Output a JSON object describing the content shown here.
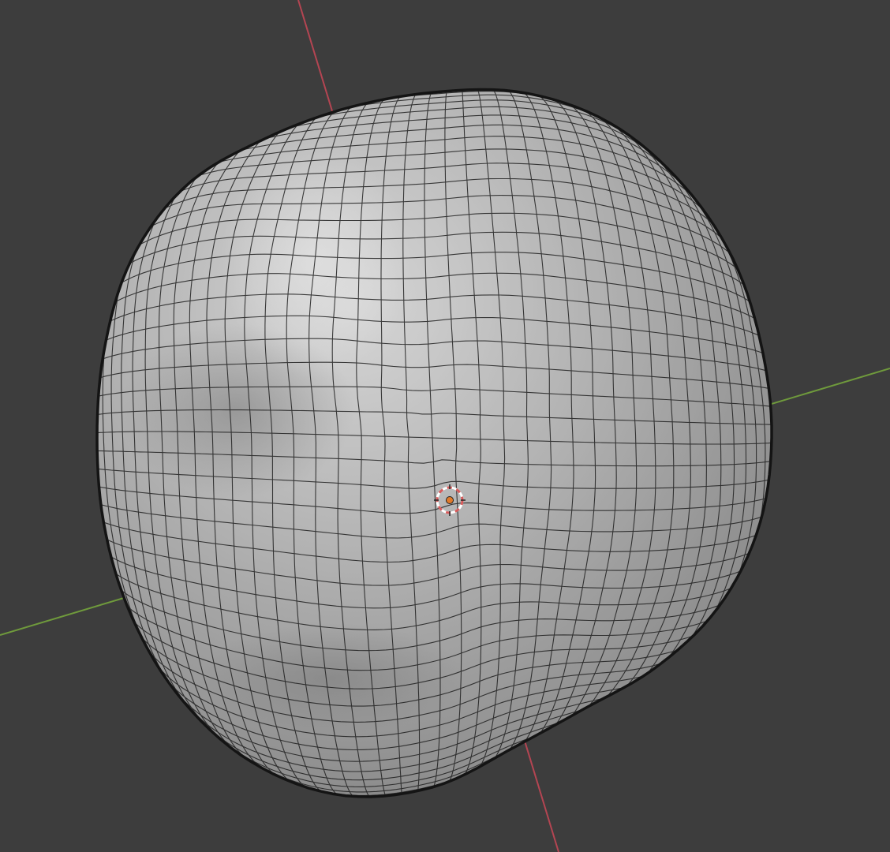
{
  "viewport": {
    "mode": "3d-viewport",
    "shading": "solid-with-wireframe-overlay",
    "object": "mesh-blob"
  },
  "colors": {
    "background": "#3d3d3d",
    "x_axis": "#b44552",
    "y_axis": "#6f9a3c",
    "mesh_base": "#a9a9a9",
    "mesh_highlight": "#d4d4d4",
    "mesh_shadow": "#6e6e6e",
    "wire": "#1f1f1f",
    "origin": "#e07a2a",
    "cursor_ring": "#d65a5a"
  },
  "icons": {
    "origin": "object-origin-icon",
    "cursor": "3d-cursor-icon"
  }
}
